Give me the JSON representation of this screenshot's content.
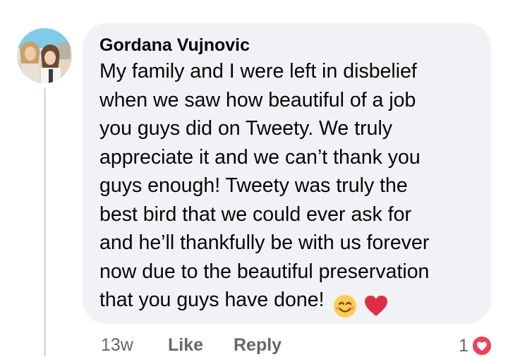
{
  "comment": {
    "author": "Gordana Vujnovic",
    "lines": [
      "My family and I were left in disbelief",
      "when we saw how beautiful of a job",
      "you guys did on Tweety. We truly",
      "appreciate it and we can’t thank you",
      "guys enough! Tweety was truly the",
      "best bird that we could ever ask for",
      "and he’ll thankfully be with us forever",
      "now due to the beautiful preservation",
      "that you guys have done!"
    ],
    "emojis": [
      "smiling-face-icon",
      "red-heart-icon"
    ]
  },
  "actions": {
    "timestamp": "13w",
    "like_label": "Like",
    "reply_label": "Reply"
  },
  "reactions": {
    "count": "1",
    "icon": "love-reaction-icon",
    "badge_color": "#f33e58"
  },
  "colors": {
    "bubble": "#f0f2f5",
    "text": "#050505",
    "secondary_text": "#65676b"
  }
}
